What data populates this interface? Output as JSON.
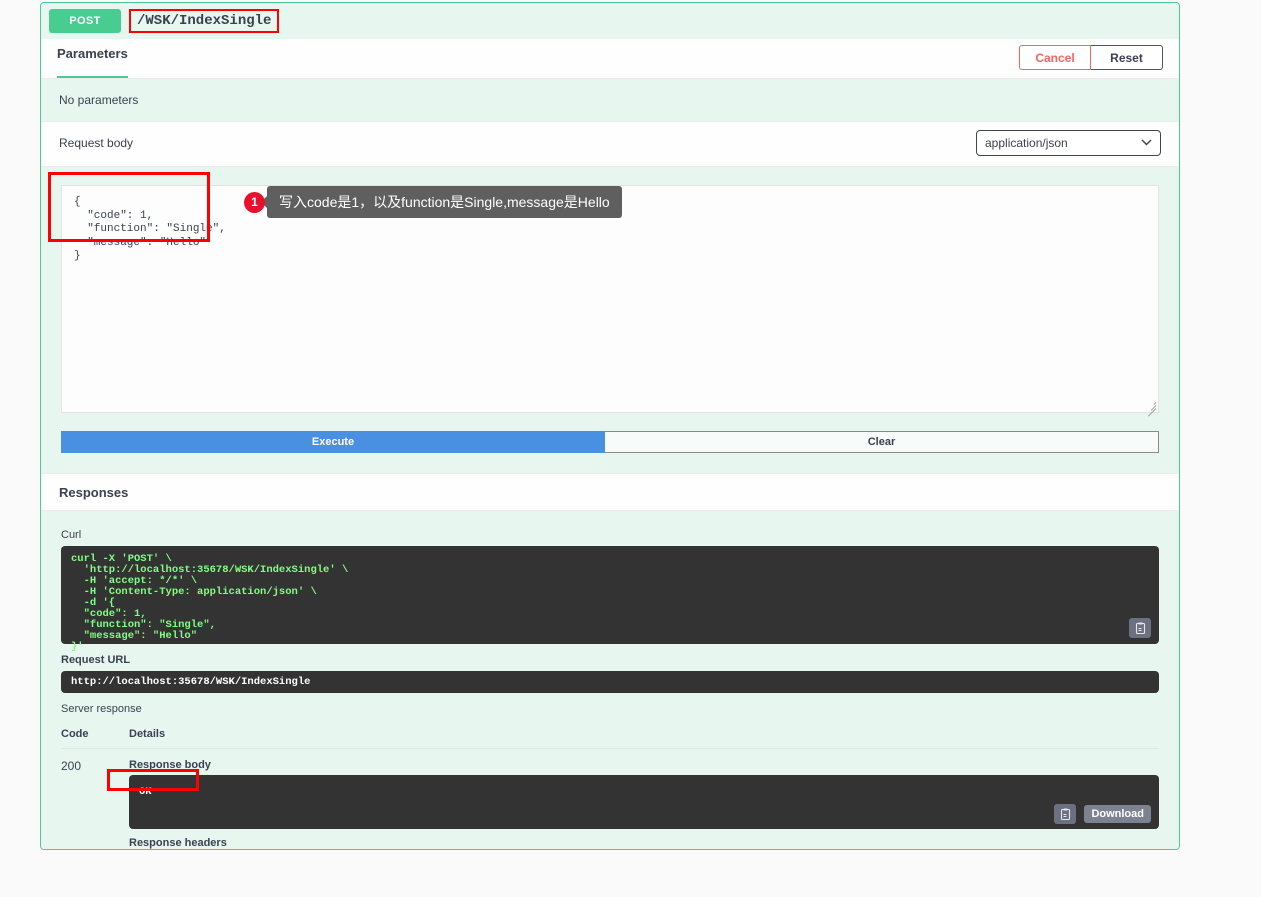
{
  "operation": {
    "method": "POST",
    "path": "/WSK/IndexSingle"
  },
  "tabs": {
    "parameters_label": "Parameters",
    "no_parameters_text": "No parameters"
  },
  "header_buttons": {
    "cancel_label": "Cancel",
    "reset_label": "Reset"
  },
  "request_body": {
    "label": "Request body",
    "mime_value": "application/json",
    "chevron": "⌄",
    "editor_content": "{\n  \"code\": 1,\n  \"function\": \"Single\",\n  \"message\": \"Hello\"\n}"
  },
  "actions": {
    "execute_label": "Execute",
    "clear_label": "Clear"
  },
  "responses": {
    "section_title": "Responses",
    "curl_label": "Curl",
    "curl_command": "curl -X 'POST' \\\n  'http://localhost:35678/WSK/IndexSingle' \\\n  -H 'accept: */*' \\\n  -H 'Content-Type: application/json' \\\n  -d '{\n  \"code\": 1,\n  \"function\": \"Single\",\n  \"message\": \"Hello\"\n}'",
    "request_url_label": "Request URL",
    "request_url": "http://localhost:35678/WSK/IndexSingle",
    "server_response_label": "Server response",
    "col_code": "Code",
    "col_details": "Details",
    "status_code": "200",
    "response_body_label": "Response body",
    "response_body_value": "OK",
    "download_label": "Download",
    "response_headers_label": "Response headers"
  },
  "annotation": {
    "number": "1",
    "text": "写入code是1，以及function是Single,message是Hello"
  },
  "colors": {
    "method_green": "#49cc90",
    "panel_green_bg": "#e8f6f0",
    "execute_blue": "#4990e2",
    "highlight_red": "#ff0000",
    "cancel_red": "#ff6060",
    "code_bg": "#333333",
    "code_text_green": "#80ff80",
    "callout_gray": "#5f5f5f",
    "badge_red": "#e8112d"
  },
  "icons": {
    "copy": "clipboard-copy-icon",
    "chevron": "chevron-down-icon",
    "resize": "resize-grip-icon"
  }
}
